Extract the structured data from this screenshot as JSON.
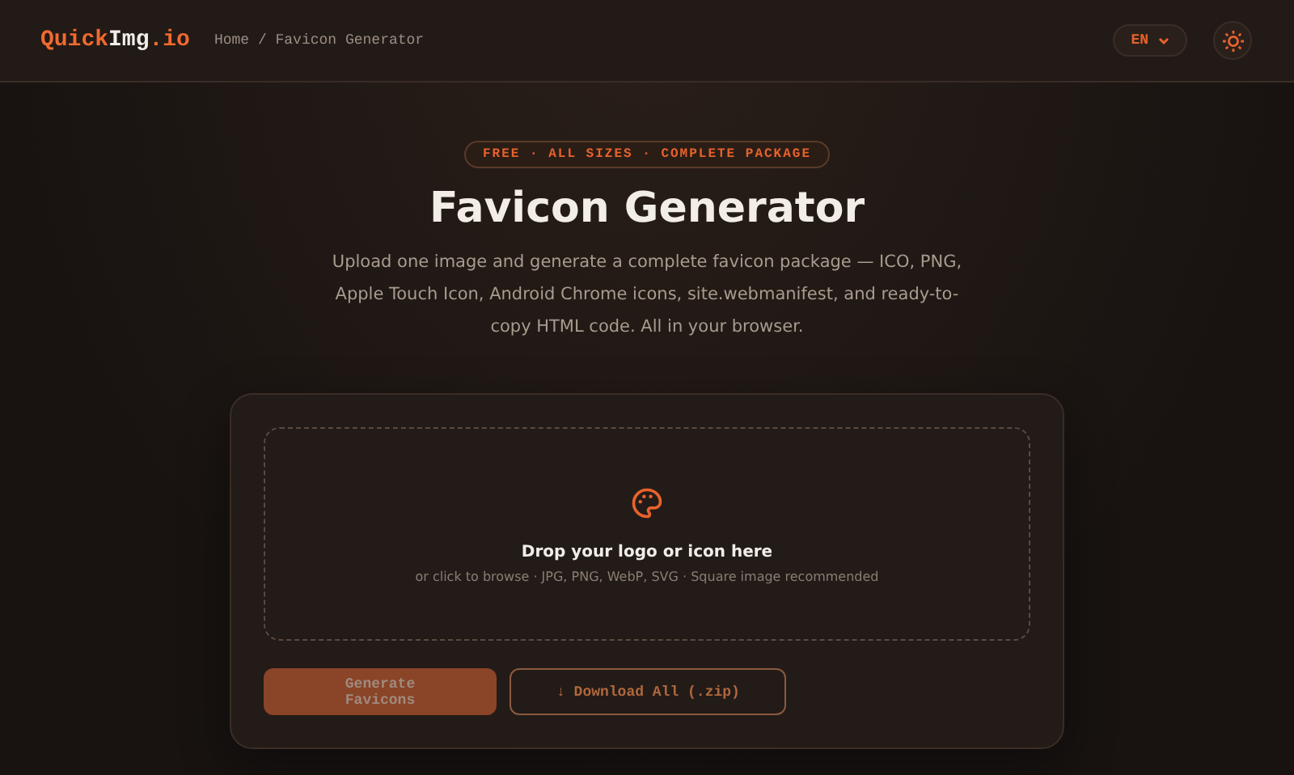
{
  "header": {
    "logo": [
      {
        "text": "Quick",
        "accent": true
      },
      {
        "text": "Img",
        "accent": false
      },
      {
        "text": ".io",
        "accent": true
      }
    ],
    "breadcrumb": "Home / Favicon Generator",
    "language": {
      "label": "EN"
    }
  },
  "hero": {
    "badge": "FREE · ALL SIZES · COMPLETE PACKAGE",
    "title": "Favicon Generator",
    "description": "Upload one image and generate a complete favicon package — ICO, PNG, Apple Touch Icon, Android Chrome icons, site.webmanifest, and ready-to-copy HTML code. All in your browser."
  },
  "dropzone": {
    "title": "Drop your logo or icon here",
    "hint": "or click to browse · JPG, PNG, WebP, SVG · Square image recommended"
  },
  "buttons": [
    {
      "label": "Generate Favicons",
      "kind": "primary",
      "disabled": true
    },
    {
      "label": "↓ Download All (.zip)",
      "kind": "secondary",
      "disabled": true
    }
  ]
}
